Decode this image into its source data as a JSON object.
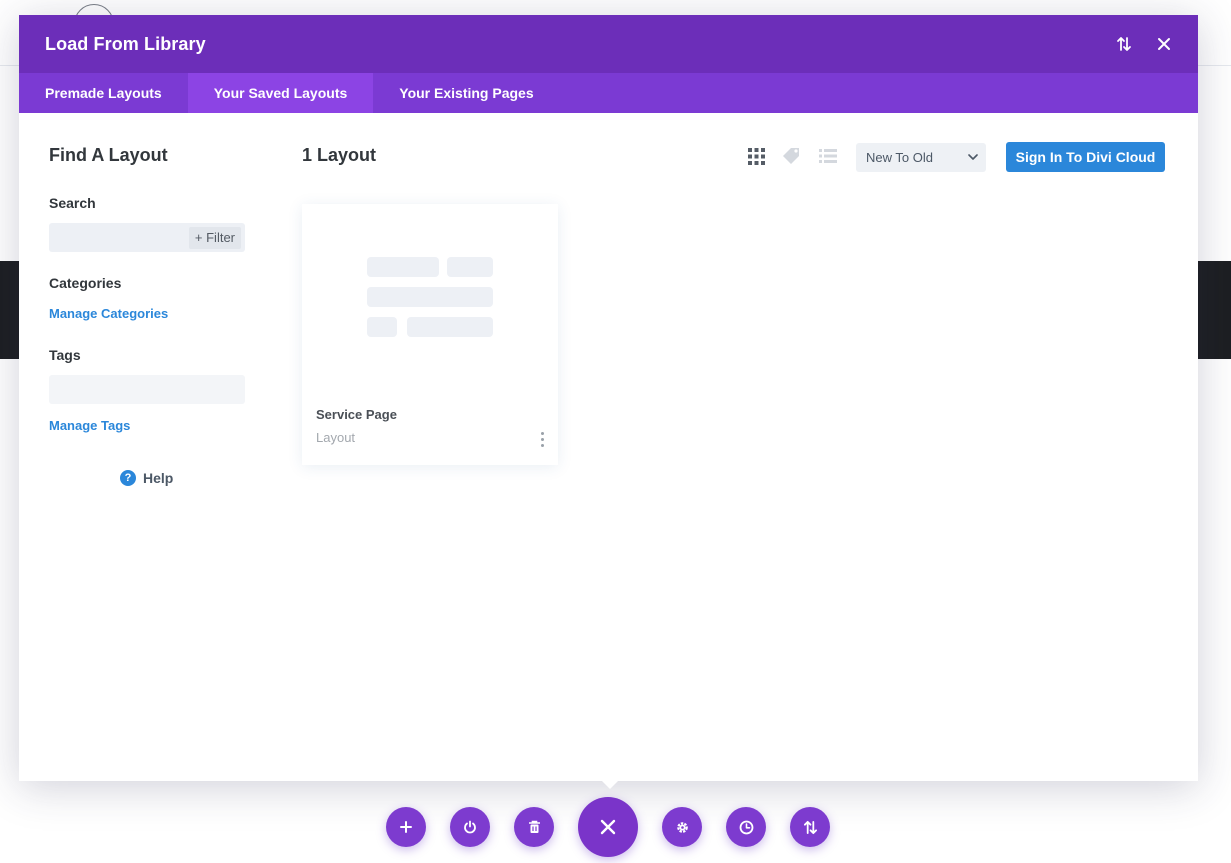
{
  "modal": {
    "title": "Load From Library",
    "tabs": [
      {
        "label": "Premade Layouts",
        "active": false
      },
      {
        "label": "Your Saved Layouts",
        "active": true
      },
      {
        "label": "Your Existing Pages",
        "active": false
      }
    ],
    "header_icons": [
      "sort-icon",
      "close-icon"
    ]
  },
  "sidebar": {
    "heading": "Find A Layout",
    "search_label": "Search",
    "filter_label": "+ Filter",
    "categories_label": "Categories",
    "manage_categories": "Manage Categories",
    "tags_label": "Tags",
    "manage_tags": "Manage Tags",
    "help_label": "Help"
  },
  "content": {
    "count_label": "1 Layout",
    "view_icons": [
      "grid-view-icon",
      "tag-view-icon",
      "list-view-icon"
    ],
    "sort_value": "New To Old",
    "cloud_button": "Sign In To Divi Cloud",
    "layouts": [
      {
        "title": "Service Page",
        "type": "Layout"
      }
    ]
  },
  "bottom_bar": {
    "buttons": [
      "plus-icon",
      "power-icon",
      "trash-icon",
      "close-icon",
      "gear-icon",
      "history-icon",
      "sort-icon"
    ]
  },
  "colors": {
    "header": "#6c2eb9",
    "tabs": "#7b3ad3",
    "active_tab": "#8c44e4",
    "accent": "#2b87da",
    "fab": "#7d3bcf"
  }
}
